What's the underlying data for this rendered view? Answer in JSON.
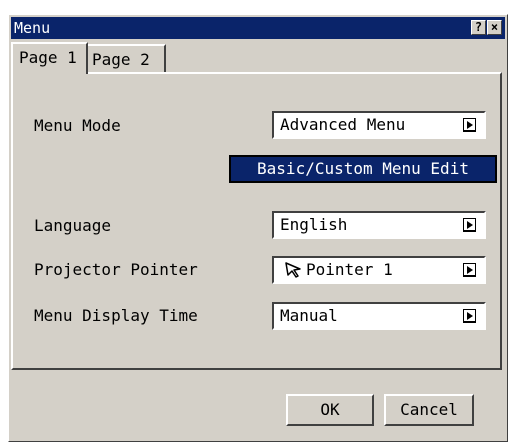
{
  "window": {
    "title": "Menu",
    "help_label": "?",
    "close_label": "×"
  },
  "tabs": [
    {
      "label": "Page 1"
    },
    {
      "label": "Page 2"
    }
  ],
  "settings": {
    "menu_mode": {
      "label": "Menu Mode",
      "value": "Advanced Menu"
    },
    "custom_edit_button": "Basic/Custom Menu Edit",
    "language": {
      "label": "Language",
      "value": "English"
    },
    "projector_pointer": {
      "label": "Projector Pointer",
      "value": "Pointer 1",
      "icon": "arrow-pointer-icon"
    },
    "menu_display_time": {
      "label": "Menu Display Time",
      "value": "Manual"
    }
  },
  "footer": {
    "ok_label": "OK",
    "cancel_label": "Cancel"
  },
  "colors": {
    "titlebar": "#0a246a",
    "dialog_bg": "#d4d0c8",
    "selected_button": "#0a246a"
  }
}
